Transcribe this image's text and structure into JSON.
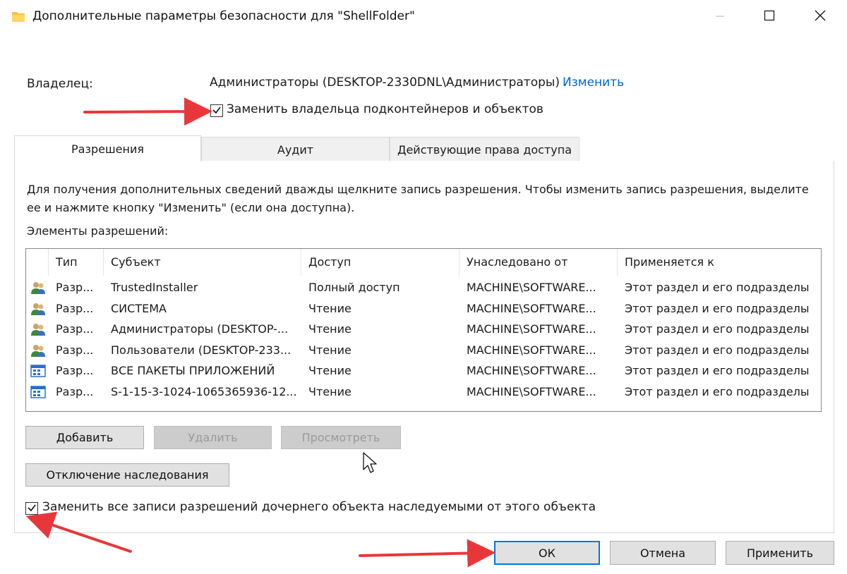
{
  "window": {
    "title": "Дополнительные параметры безопасности  для \"ShellFolder\""
  },
  "owner": {
    "label": "Владелец:",
    "value": "Администраторы (DESKTOP-2330DNL\\Администраторы)",
    "change_link": "Изменить",
    "replace_checkbox_label": "Заменить владельца подконтейнеров и объектов",
    "replace_checked": true
  },
  "tabs": [
    {
      "label": "Разрешения",
      "active": true
    },
    {
      "label": "Аудит",
      "active": false
    },
    {
      "label": "Действующие права доступа",
      "active": false
    }
  ],
  "permissions": {
    "hint": "Для получения дополнительных сведений дважды щелкните запись разрешения. Чтобы изменить запись разрешения, выделите ее и нажмите кнопку \"Изменить\" (если она доступна).",
    "elements_label": "Элементы разрешений:",
    "columns": [
      "Тип",
      "Субъект",
      "Доступ",
      "Унаследовано от",
      "Применяется к"
    ],
    "rows": [
      {
        "icon": "users-group-icon",
        "type": "Разр...",
        "subject": "TrustedInstaller",
        "access": "Полный доступ",
        "inherited": "MACHINE\\SOFTWARE...",
        "applies": "Этот раздел и его подразделы"
      },
      {
        "icon": "users-group-icon",
        "type": "Разр...",
        "subject": "СИСТЕМА",
        "access": "Чтение",
        "inherited": "MACHINE\\SOFTWARE...",
        "applies": "Этот раздел и его подразделы"
      },
      {
        "icon": "users-group-icon",
        "type": "Разр...",
        "subject": "Администраторы (DESKTOP-...",
        "access": "Чтение",
        "inherited": "MACHINE\\SOFTWARE...",
        "applies": "Этот раздел и его подразделы"
      },
      {
        "icon": "users-group-icon",
        "type": "Разр...",
        "subject": "Пользователи (DESKTOP-233...",
        "access": "Чтение",
        "inherited": "MACHINE\\SOFTWARE...",
        "applies": "Этот раздел и его подразделы"
      },
      {
        "icon": "app-package-icon",
        "type": "Разр...",
        "subject": "ВСЕ ПАКЕТЫ ПРИЛОЖЕНИЙ",
        "access": "Чтение",
        "inherited": "MACHINE\\SOFTWARE...",
        "applies": "Этот раздел и его подразделы"
      },
      {
        "icon": "app-package-icon",
        "type": "Разр...",
        "subject": "S-1-15-3-1024-1065365936-12...",
        "access": "Чтение",
        "inherited": "MACHINE\\SOFTWARE...",
        "applies": "Этот раздел и его подразделы"
      }
    ],
    "add_button": "Добавить",
    "remove_button": "Удалить",
    "view_button": "Просмотреть",
    "disable_inheritance_button": "Отключение наследования",
    "replace_child_label": "Заменить все записи разрешений дочернего объекта наследуемыми от этого объекта",
    "replace_child_checked": true
  },
  "footer": {
    "ok": "ОК",
    "cancel": "Отмена",
    "apply": "Применить"
  },
  "colors": {
    "link": "#0066cc",
    "arrow": "#e8373a",
    "ok_border": "#0078d7"
  }
}
